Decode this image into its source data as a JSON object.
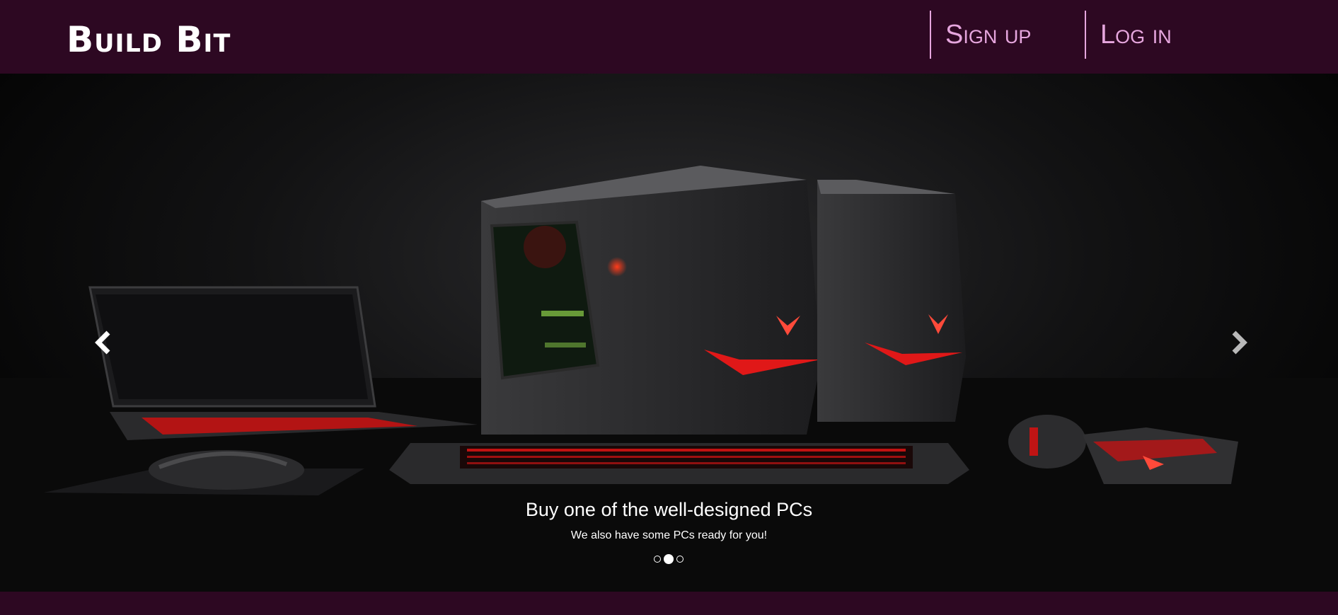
{
  "brand": {
    "name": "Build Bit"
  },
  "nav": {
    "signup_label": "Sign up",
    "login_label": "Log in"
  },
  "carousel": {
    "caption_title": "Buy one of the well-designed PCs",
    "caption_subtitle": "We also have some PCs ready for you!",
    "slide_count": 3,
    "active_slide": 2
  },
  "colors": {
    "nav_bg": "#2d0822",
    "nav_link": "#e6a6de",
    "accent_red": "#e01818"
  },
  "icons": {
    "prev": "chevron-left-icon",
    "next": "chevron-right-icon"
  }
}
